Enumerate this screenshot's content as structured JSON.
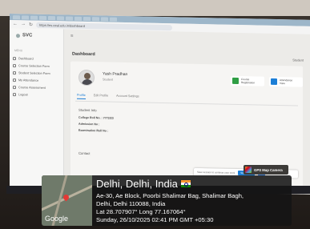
{
  "browser": {
    "url": "https://es.eeal.edu.in/dashboard"
  },
  "sidebar": {
    "brand": "SVC",
    "menu_heading": "MENU",
    "items": [
      {
        "label": "Dashboard"
      },
      {
        "label": "Course Selection Form"
      },
      {
        "label": "Student Selection Form"
      },
      {
        "label": "My Attendance"
      },
      {
        "label": "Course Assessment"
      },
      {
        "label": "Logout"
      }
    ]
  },
  "main": {
    "page_title": "Dashboard",
    "login_as": "Student",
    "profile": {
      "name": "Yash Pradhan",
      "role": "Student"
    },
    "stats": [
      {
        "label": "Course",
        "sub": "Registration",
        "color": "#2f9e44"
      },
      {
        "label": "Attendance",
        "sub": "View",
        "color": "#1c7ed6"
      }
    ],
    "tabs": [
      {
        "label": "Profile",
        "active": true
      },
      {
        "label": "Edit Profile",
        "active": false
      },
      {
        "label": "Account Settings",
        "active": false
      }
    ],
    "student_info_title": "Student Info",
    "fields": [
      {
        "label": "College Roll No. : 7772/23"
      },
      {
        "label": "Admission No :"
      },
      {
        "label": "Examination Roll No :"
      }
    ],
    "contact_title": "Contact",
    "modal": {
      "text": "Save session to continue your work",
      "primary": "Stay Active",
      "secondary": "Exit"
    }
  },
  "gps": {
    "badge": "GPS Map Camera",
    "map_brand": "Google",
    "title": "Delhi, Delhi, India",
    "address_line1": "Ae-30, Ae Block, Poorbi Shalimar Bag, Shalimar Bagh,",
    "address_line2": "Delhi, Delhi 110088, India",
    "coords": "Lat 28.707907° Long 77.167064°",
    "datetime": "Sunday, 26/10/2025 02:41 PM GMT +05:30"
  }
}
